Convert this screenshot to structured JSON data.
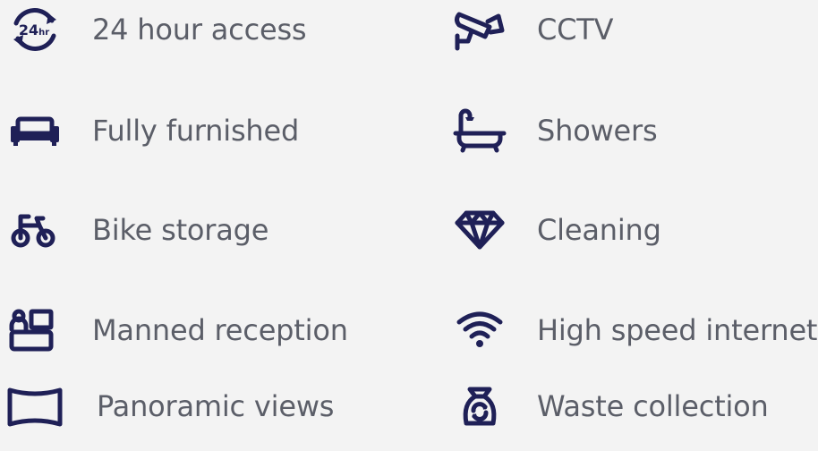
{
  "colors": {
    "icon": "#1f2057",
    "text": "#5b5e68",
    "background": "#f3f3f3"
  },
  "amenities": {
    "left": [
      {
        "label": "24 hour access",
        "icon": "24hr-icon"
      },
      {
        "label": "Fully furnished",
        "icon": "sofa-icon"
      },
      {
        "label": "Bike storage",
        "icon": "bike-icon"
      },
      {
        "label": "Manned reception",
        "icon": "reception-desk-icon"
      },
      {
        "label": "Panoramic views",
        "icon": "panorama-icon"
      }
    ],
    "right": [
      {
        "label": "CCTV",
        "icon": "cctv-camera-icon"
      },
      {
        "label": "Showers",
        "icon": "bathtub-shower-icon"
      },
      {
        "label": "Cleaning",
        "icon": "diamond-icon"
      },
      {
        "label": "High speed internet",
        "icon": "wifi-icon"
      },
      {
        "label": "Waste collection",
        "icon": "waste-bag-icon"
      }
    ],
    "hr_badge_text": "24hr"
  }
}
